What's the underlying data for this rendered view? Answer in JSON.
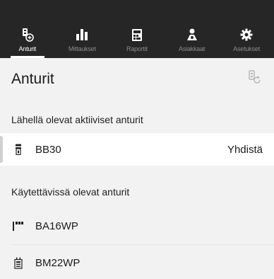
{
  "nav": {
    "tabs": [
      {
        "label": "Anturit",
        "icon": "sensor-icon",
        "active": true
      },
      {
        "label": "Mittaukset",
        "icon": "bar-chart-icon",
        "active": false
      },
      {
        "label": "Raportit",
        "icon": "report-icon",
        "active": false
      },
      {
        "label": "Asiakkaat",
        "icon": "customers-icon",
        "active": false
      },
      {
        "label": "Asetukset",
        "icon": "gear-icon",
        "active": false
      }
    ]
  },
  "header": {
    "title": "Anturit",
    "refresh_icon": "sensor-refresh-icon"
  },
  "sections": {
    "nearby_title": "Lähellä olevat aktiiviset anturit",
    "nearby": [
      {
        "name": "BB30",
        "icon": "bb-sensor-icon",
        "action": "Yhdistä"
      }
    ],
    "available_title": "Käytettävissä olevat anturit",
    "available": [
      {
        "name": "BA16WP",
        "icon": "ba-sensor-icon"
      },
      {
        "name": "BM22WP",
        "icon": "bm-sensor-icon"
      }
    ]
  },
  "colors": {
    "topbar": "#262626",
    "background": "#f2f2f2",
    "active_tab": "#ffffff",
    "inactive_tab": "#8a8a8a"
  }
}
